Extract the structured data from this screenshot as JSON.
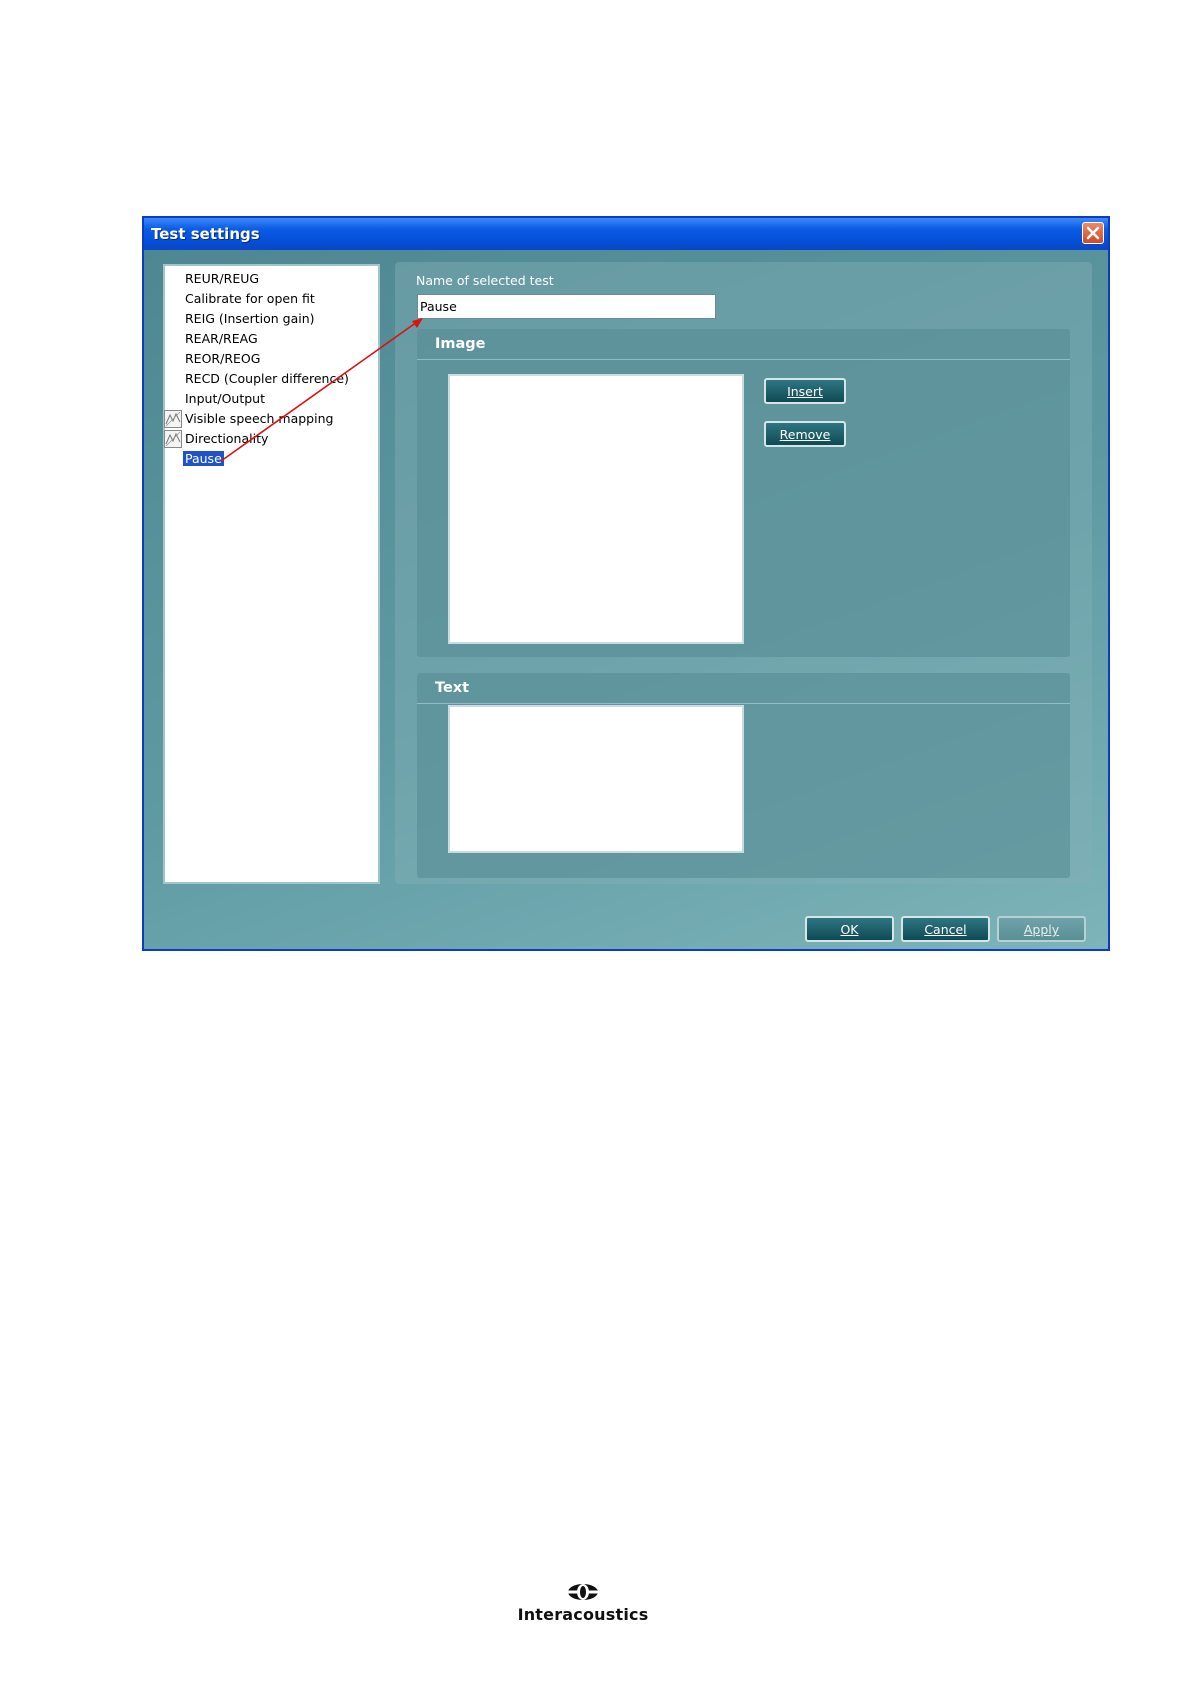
{
  "dialog": {
    "title": "Test settings",
    "test_list": [
      {
        "label": "REUR/REUG",
        "icon": ""
      },
      {
        "label": "Calibrate for open fit",
        "icon": ""
      },
      {
        "label": "REIG (Insertion gain)",
        "icon": ""
      },
      {
        "label": "REAR/REAG",
        "icon": ""
      },
      {
        "label": "REOR/REOG",
        "icon": ""
      },
      {
        "label": "RECD (Coupler difference)",
        "icon": ""
      },
      {
        "label": "Input/Output",
        "icon": ""
      },
      {
        "label": "Visible speech mapping",
        "icon": "speech-mapping-icon"
      },
      {
        "label": "Directionality",
        "icon": "directionality-icon"
      },
      {
        "label": "Pause",
        "icon": "",
        "selected": true
      }
    ],
    "name_label": "Name of selected test",
    "name_value": "Pause",
    "image_group": {
      "header": "Image",
      "insert_label": "Insert",
      "remove_label": "Remove"
    },
    "text_group": {
      "header": "Text"
    },
    "footer": {
      "ok_label": "OK",
      "cancel_label": "Cancel",
      "apply_label": "Apply"
    }
  },
  "logo": {
    "text": "Interacoustics"
  },
  "colors": {
    "title_bar": "#0b5be6",
    "dialog_bg": "#5c969f",
    "selection": "#2052c8",
    "annotation_arrow": "#e01010"
  }
}
